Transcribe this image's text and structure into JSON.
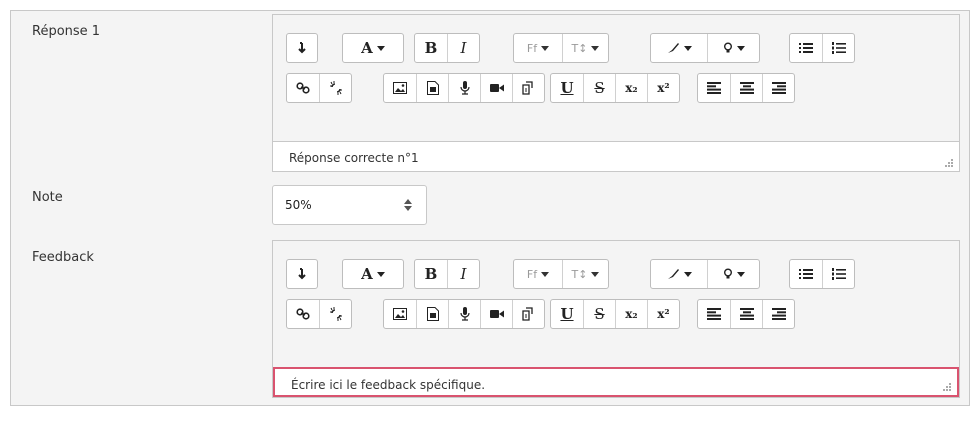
{
  "fields": {
    "response_label": "Réponse 1",
    "grade_label": "Note",
    "feedback_label": "Feedback"
  },
  "response_editor": {
    "value": "Réponse correcte n°1"
  },
  "feedback_editor": {
    "value": "Écrire ici le feedback spécifique."
  },
  "grade_select": {
    "value": "50%"
  },
  "toolbar": {
    "bold": "B",
    "italic": "I",
    "font_family": "Ff",
    "font_size": "T↕",
    "underline": "U",
    "strike": "S",
    "subscript": "x₂",
    "superscript": "x²"
  },
  "colors": {
    "focus_border": "#d9536f",
    "panel_bg": "#f4f4f4"
  }
}
